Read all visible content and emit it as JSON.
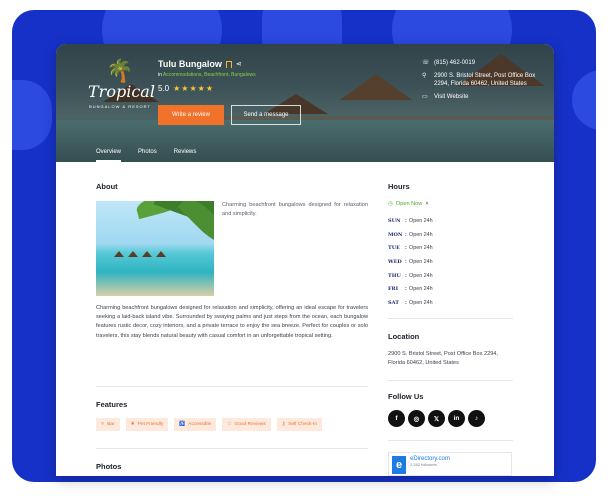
{
  "hero": {
    "title": "Tulu Bungalow",
    "in_prefix": "in",
    "categories": "Accommodations, Beachfront, Bungalows",
    "rating": "5.0",
    "stars": "★★★★★",
    "review_button": "Write a review",
    "message_button": "Send a message",
    "logo_script": "Tropical",
    "logo_tagline": "BUNGALOW & RESORT"
  },
  "contact": {
    "phone": "(815) 462-0019",
    "address": "2900 S. Bristol Street, Post Office Box 2294, Florida 60462, United States",
    "website": "Visit Website"
  },
  "tabs": [
    "Overview",
    "Photos",
    "Reviews"
  ],
  "about": {
    "heading": "About",
    "summary": "Charming beachfront bungalows designed for relaxation and simplicity.",
    "description": "Charming beachfront bungalows designed for relaxation and simplicity, offering an ideal escape for travelers seeking a laid-back island vibe. Surrounded by swaying palms and just steps from the ocean, each bungalow features rustic decor, cozy interiors, and a private terrace to enjoy the sea breeze. Perfect for couples or solo travelers, this stay blends natural beauty with casual comfort in an unforgettable tropical setting."
  },
  "features": {
    "heading": "Features",
    "items": [
      {
        "label": "Bar",
        "icon": "glass-icon"
      },
      {
        "label": "Pet Friendly",
        "icon": "paw-icon"
      },
      {
        "label": "Accessible",
        "icon": "wheelchair-icon"
      },
      {
        "label": "Good Reviews",
        "icon": "star-icon"
      },
      {
        "label": "Self Check-In",
        "icon": "key-icon"
      }
    ]
  },
  "photos": {
    "heading": "Photos"
  },
  "hours": {
    "heading": "Hours",
    "status": "Open Now",
    "days": [
      {
        "day": "SUN",
        "value": "Open 24h"
      },
      {
        "day": "MON",
        "value": "Open 24h"
      },
      {
        "day": "TUE",
        "value": "Open 24h"
      },
      {
        "day": "WED",
        "value": "Open 24h"
      },
      {
        "day": "THU",
        "value": "Open 24h"
      },
      {
        "day": "FRI",
        "value": "Open 24h"
      },
      {
        "day": "SAT",
        "value": "Open 24h"
      }
    ]
  },
  "location": {
    "heading": "Location",
    "address": "2900 S. Bristol Street, Post Office Box 2294, Florida 60462, United States"
  },
  "follow": {
    "heading": "Follow Us",
    "networks": [
      "f",
      "◎",
      "𝕏",
      "in",
      "♪"
    ]
  },
  "widget": {
    "name": "eDirectory.com",
    "followers": "2,282 followers"
  },
  "colors": {
    "frame": "#1631c8",
    "accent": "#f0722b",
    "open": "#4caa2a",
    "star": "#f9c73c"
  }
}
